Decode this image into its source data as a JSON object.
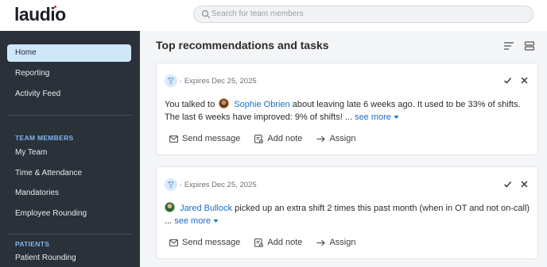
{
  "brand": {
    "logo": "laudio",
    "accent": "#e0323b"
  },
  "search": {
    "placeholder": "Search for team members"
  },
  "sidebar": {
    "items": [
      {
        "label": "Home",
        "active": true
      },
      {
        "label": "Reporting"
      },
      {
        "label": "Activity Feed"
      }
    ],
    "team_heading": "TEAM MEMBERS",
    "team_items": [
      {
        "label": "My Team"
      },
      {
        "label": "Time & Attendance"
      },
      {
        "label": "Mandatories"
      },
      {
        "label": "Employee Rounding"
      }
    ],
    "patients_heading": "PATIENTS",
    "patients_items": [
      {
        "label": "Patient Rounding"
      }
    ]
  },
  "main": {
    "title": "Top recommendations and tasks",
    "cards": [
      {
        "expires": "Expires Dec 25, 2025",
        "text_before": "You talked to",
        "person": "Sophie Obrien",
        "text_after": "about leaving late 6 weeks ago. It used to be 33% of shifts. The last 6 weeks have improved: 9% of shifts! ...",
        "see_more": "see more",
        "actions": {
          "send": "Send message",
          "note": "Add note",
          "assign": "Assign"
        }
      },
      {
        "expires": "Expires Dec 25, 2025",
        "person": "Jared Bullock",
        "text_after": "picked up an extra shift 2 times this past month (when in OT and not on-call) ...",
        "see_more": "see more",
        "actions": {
          "send": "Send message",
          "note": "Add note",
          "assign": "Assign"
        }
      }
    ]
  },
  "icons": [
    "search-icon",
    "sort-icon",
    "view-toggle-icon",
    "trophy-icon",
    "check-icon",
    "close-icon",
    "mail-icon",
    "note-icon",
    "assign-arrow-icon",
    "caret-down-icon"
  ]
}
